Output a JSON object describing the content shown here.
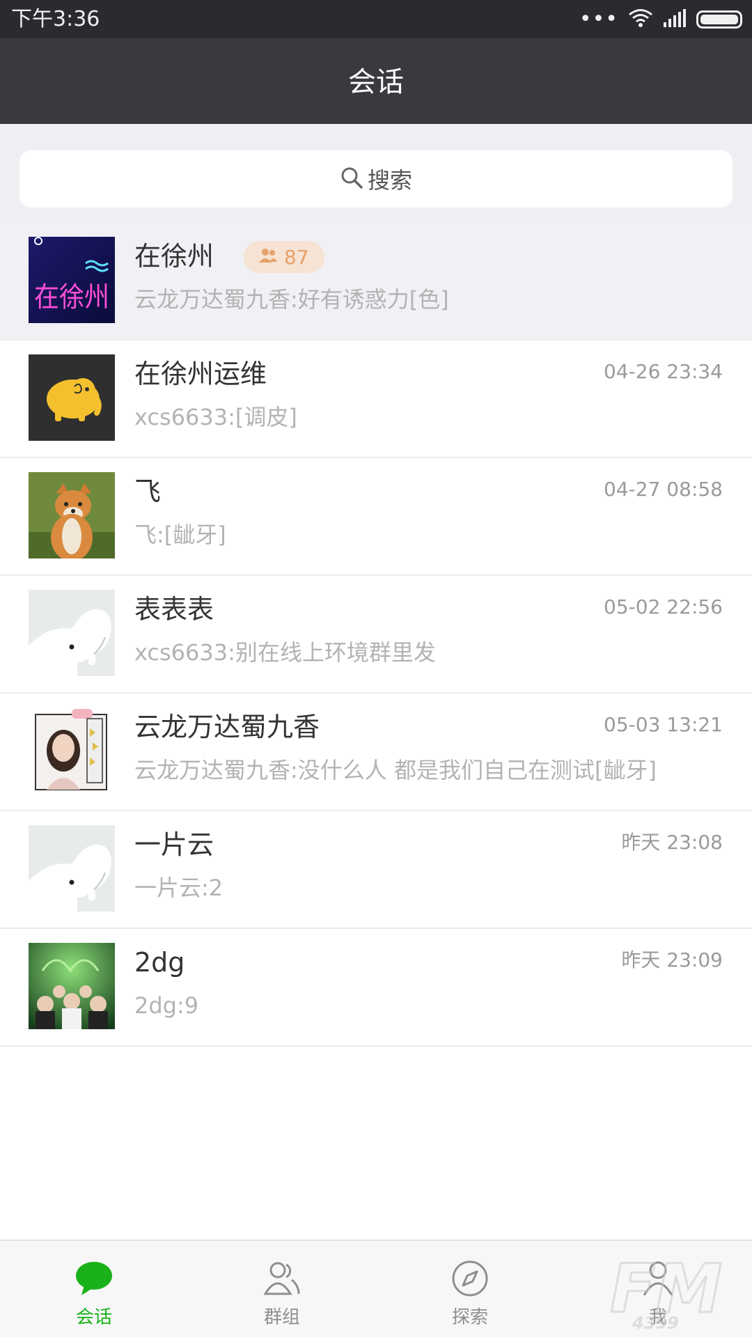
{
  "status_bar": {
    "time": "下午3:36",
    "more": "•••"
  },
  "header": {
    "title": "会话"
  },
  "search": {
    "label": "搜索"
  },
  "conversations": [
    {
      "name": "在徐州",
      "preview": "云龙万达蜀九香:好有诱惑力[色]",
      "time": "",
      "members": "87",
      "avatar": "xuzhou-poster",
      "avatar_text": "在徐州",
      "pinned": true
    },
    {
      "name": "在徐州运维",
      "preview": "xcs6633:[调皮]",
      "time": "04-26 23:34",
      "avatar": "yellow-elephant"
    },
    {
      "name": "飞",
      "preview": "飞:[龇牙]",
      "time": "04-27 08:58",
      "avatar": "shiba-dog"
    },
    {
      "name": "表表表",
      "preview": "xcs6633:别在线上环境群里发",
      "time": "05-02 22:56",
      "avatar": "default-elephant"
    },
    {
      "name": "云龙万达蜀九香",
      "preview": "云龙万达蜀九香:没什么人 都是我们自己在测试[龇牙]",
      "time": "05-03 13:21",
      "avatar": "girl-photo"
    },
    {
      "name": "一片云",
      "preview": "一片云:2",
      "time": "昨天 23:08",
      "avatar": "default-elephant"
    },
    {
      "name": "2dg",
      "preview": "2dg:9",
      "time": "昨天 23:09",
      "avatar": "green-poster"
    }
  ],
  "tabs": [
    {
      "label": "会话",
      "icon": "chat-bubble-icon",
      "active": true
    },
    {
      "label": "群组",
      "icon": "group-icon",
      "active": false
    },
    {
      "label": "探索",
      "icon": "compass-icon",
      "active": false
    },
    {
      "label": "我",
      "icon": "person-icon",
      "active": false
    }
  ],
  "watermark": {
    "text": "FM",
    "sub": "4399"
  },
  "colors": {
    "accent": "#1ab21a",
    "header_bg": "#3a3940",
    "status_bg": "#2b2a30",
    "badge_bg": "#f6e3d3",
    "badge_text": "#e6a26b"
  }
}
